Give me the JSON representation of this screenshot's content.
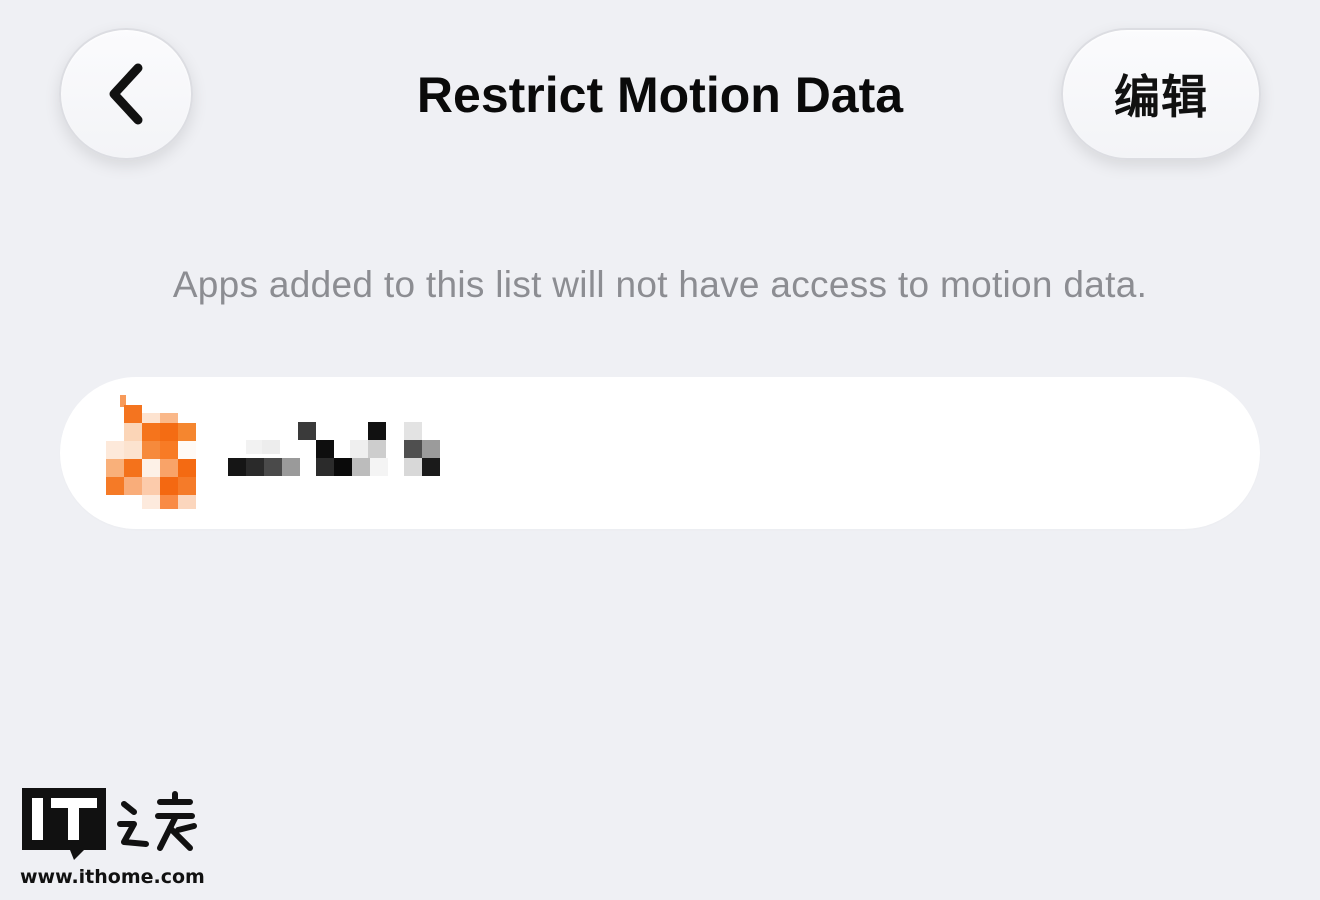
{
  "nav": {
    "title": "Restrict Motion Data",
    "back_icon": "chevron-left-icon",
    "edit_label": "编辑"
  },
  "description": "Apps added to this list will not have access to motion data.",
  "app_list": {
    "items": [
      {
        "name": "",
        "icon": "pixelated-app-icon",
        "accent": "#f56b1c"
      }
    ]
  },
  "watermark": {
    "brand": "IT之家",
    "url": "www.ithome.com"
  },
  "colors": {
    "background": "#eff0f4",
    "card": "#ffffff",
    "secondary_text": "#8c8d92",
    "accent_orange": "#f56b1c"
  }
}
